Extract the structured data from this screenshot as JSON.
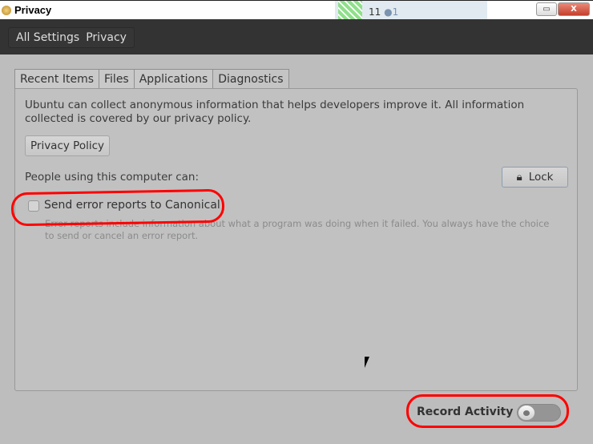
{
  "window": {
    "title": "Privacy",
    "background_window": {
      "score": "11",
      "badge": "1"
    }
  },
  "breadcrumb": [
    "All Settings",
    "Privacy"
  ],
  "tabs": [
    {
      "label": "Recent Items"
    },
    {
      "label": "Files"
    },
    {
      "label": "Applications"
    },
    {
      "label": "Diagnostics",
      "active": true
    }
  ],
  "diagnostics": {
    "description": "Ubuntu can collect anonymous information that helps developers improve it. All information collected is covered by our privacy policy.",
    "privacy_policy_button": "Privacy Policy",
    "people_label": "People using this computer can:",
    "lock_button": "Lock",
    "error_reports_label": "Send error reports to Canonical",
    "error_reports_checked": false,
    "error_reports_hint": "Error reports include information about what a program was doing when it failed. You always have the choice to send or cancel an error report."
  },
  "record_activity": {
    "label": "Record Activity",
    "enabled": false
  },
  "annotation_color": "#ff0000"
}
